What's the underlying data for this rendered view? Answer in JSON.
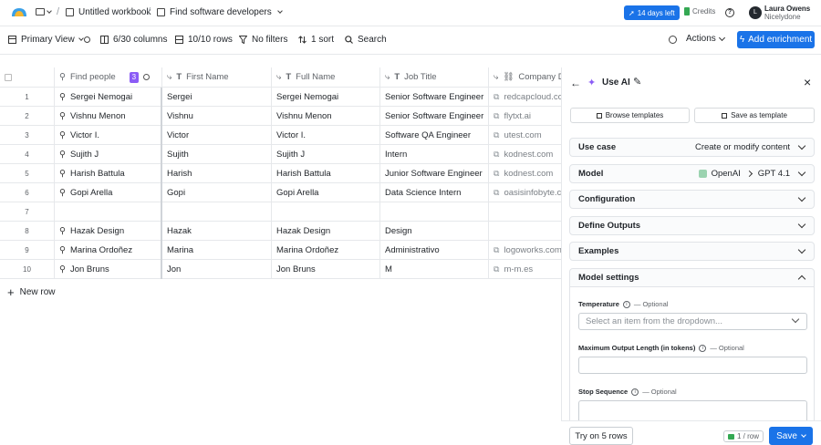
{
  "breadcrumb": {
    "workbook": "Untitled workbook",
    "table": "Find software developers"
  },
  "header": {
    "trial": "14 days left",
    "credits": "Credits",
    "user_initial": "L",
    "user_name": "Laura Owens",
    "user_org": "Nicelydone"
  },
  "toolbar": {
    "view": "Primary View",
    "columns": "6/30 columns",
    "rows": "10/10 rows",
    "filters": "No filters",
    "sort": "1 sort",
    "search": "Search",
    "actions": "Actions",
    "add_enrichment": "Add enrichment"
  },
  "table": {
    "headers": [
      "Find people",
      "First Name",
      "Full Name",
      "Job Title",
      "Company Do"
    ],
    "find_people_badge": "3",
    "rows": [
      {
        "n": "1",
        "find": "Sergei Nemogai",
        "first": "Sergei",
        "full": "Sergei Nemogai",
        "job": "Senior Software Engineer",
        "company": "redcapcloud.com"
      },
      {
        "n": "2",
        "find": "Vishnu Menon",
        "first": "Vishnu",
        "full": "Vishnu Menon",
        "job": "Senior Software Engineer",
        "company": "flytxt.ai"
      },
      {
        "n": "3",
        "find": "Victor I.",
        "first": "Victor",
        "full": "Victor I.",
        "job": "Software QA Engineer",
        "company": "utest.com"
      },
      {
        "n": "4",
        "find": "Sujith J",
        "first": "Sujith",
        "full": "Sujith J",
        "job": "Intern",
        "company": "kodnest.com"
      },
      {
        "n": "5",
        "find": "Harish Battula",
        "first": "Harish",
        "full": "Harish Battula",
        "job": "Junior Software Engineer",
        "company": "kodnest.com"
      },
      {
        "n": "6",
        "find": "Gopi Arella",
        "first": "Gopi",
        "full": "Gopi Arella",
        "job": "Data Science Intern",
        "company": "oasisinfobyte.com"
      },
      {
        "n": "7",
        "find": "",
        "first": "",
        "full": "",
        "job": "",
        "company": ""
      },
      {
        "n": "8",
        "find": "Hazak Design",
        "first": "Hazak",
        "full": "Hazak Design",
        "job": "Design",
        "company": ""
      },
      {
        "n": "9",
        "find": "Marina Ordoñez",
        "first": "Marina",
        "full": "Marina Ordoñez",
        "job": "Administrativo",
        "company": "logoworks.com"
      },
      {
        "n": "10",
        "find": "Jon Bruns",
        "first": "Jon",
        "full": "Jon Bruns",
        "job": "M",
        "company": "m-m.es"
      }
    ],
    "new_row": "New row"
  },
  "panel": {
    "title": "Use AI",
    "browse": "Browse templates",
    "save_template": "Save as template",
    "use_case_label": "Use case",
    "use_case_value": "Create or modify content",
    "model_label": "Model",
    "model_provider": "OpenAI",
    "model_name": "GPT 4.1",
    "configuration": "Configuration",
    "define_outputs": "Define Outputs",
    "examples": "Examples",
    "model_settings": "Model settings",
    "temperature_label": "Temperature",
    "optional": "— Optional",
    "temperature_placeholder": "Select an item from the dropdown...",
    "max_length_label": "Maximum Output Length (in tokens)",
    "stop_label": "Stop Sequence",
    "try_rows": "Try on 5 rows",
    "per_row": "1 / row",
    "save": "Save"
  },
  "colors": {
    "accent": "#1a73e8",
    "badge": "#8b5cf6"
  }
}
